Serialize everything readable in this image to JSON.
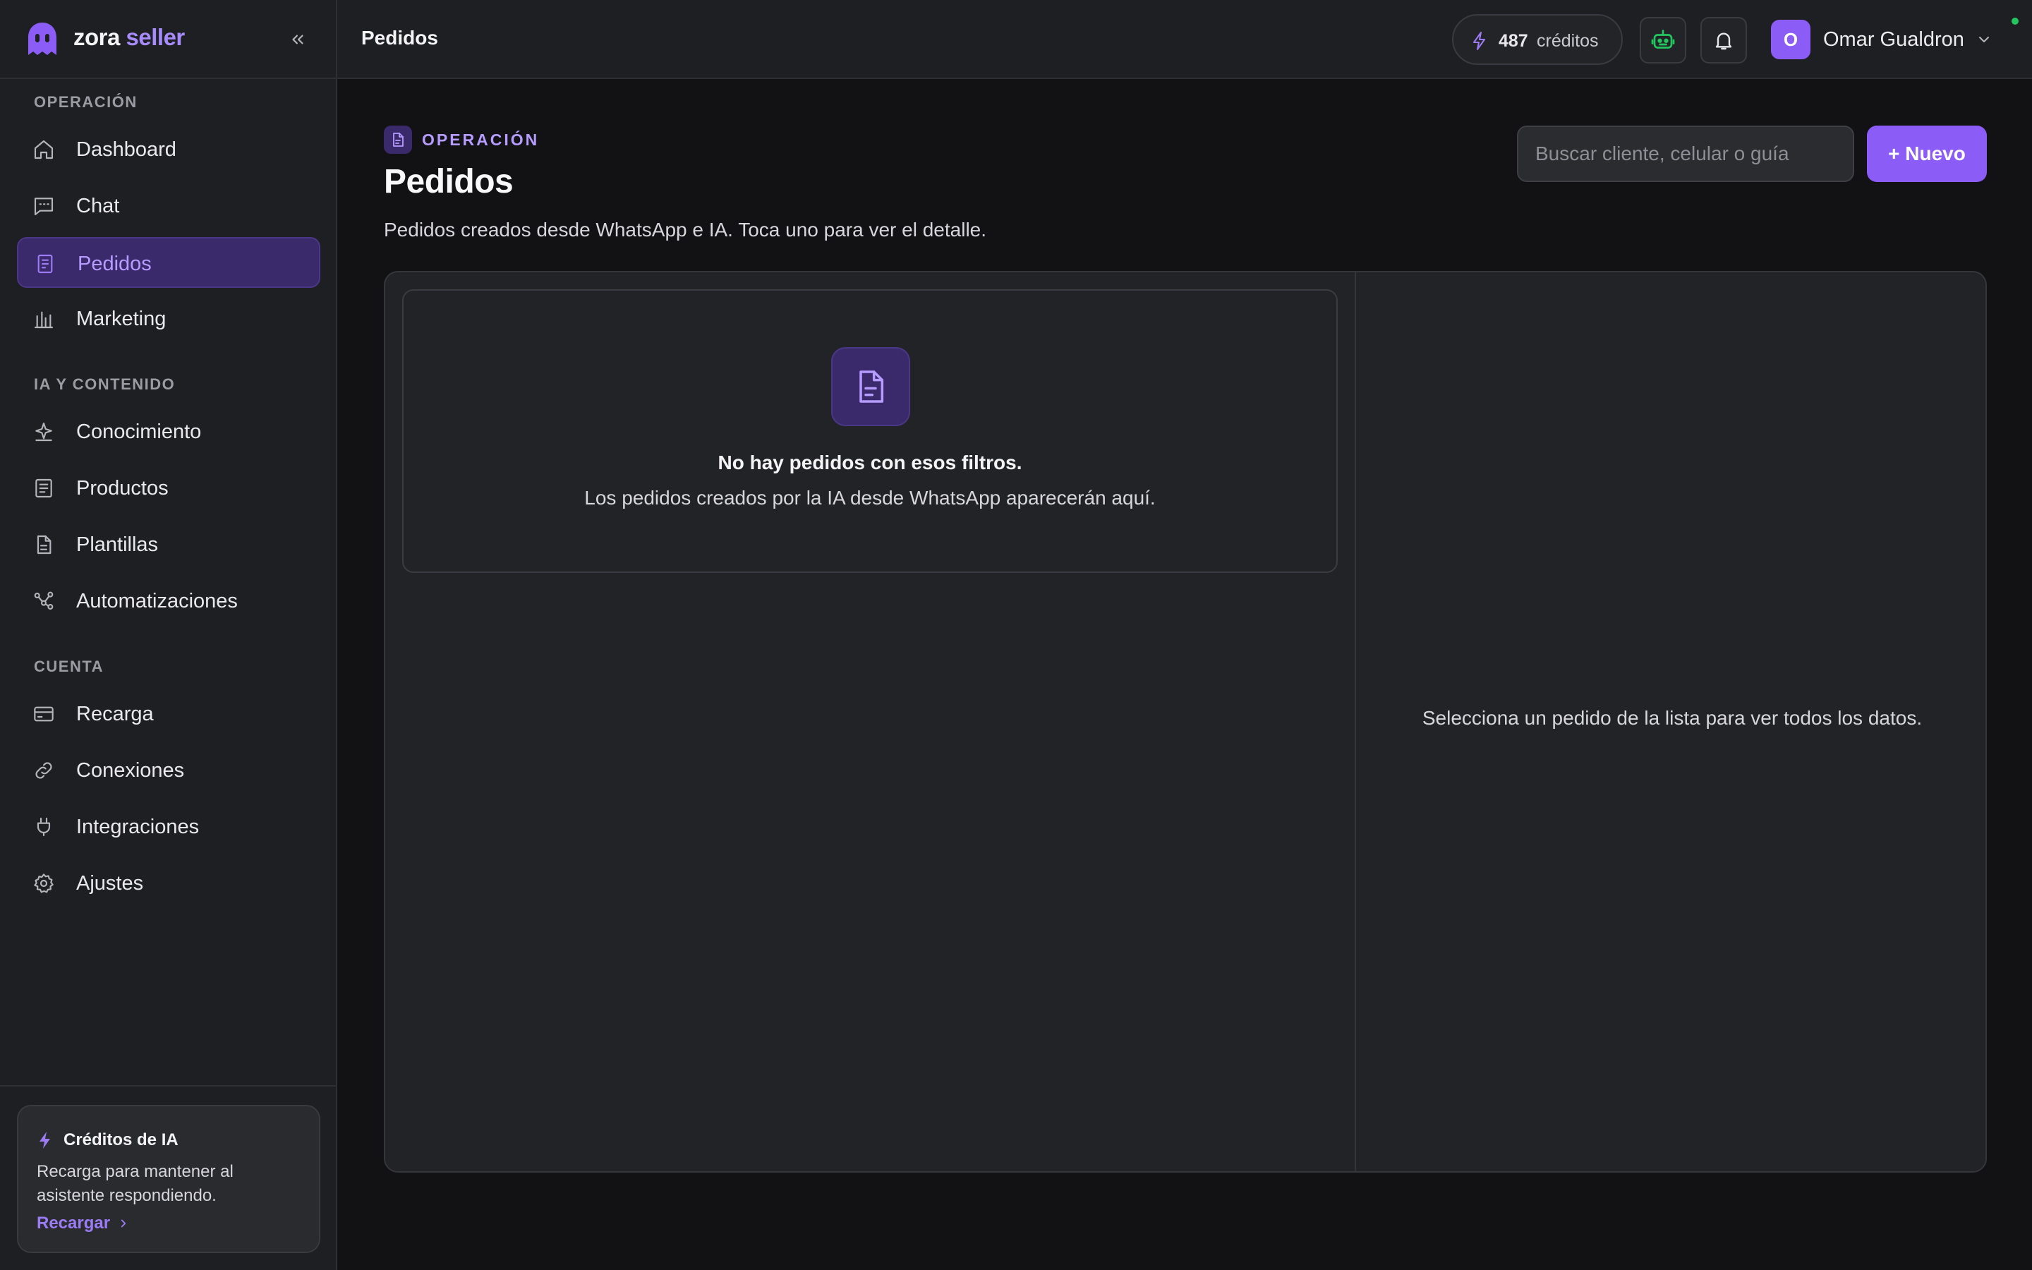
{
  "brand": {
    "name_primary": "zora",
    "name_accent": "seller"
  },
  "sidebar": {
    "sections": [
      {
        "title": "OPERACIÓN",
        "items": [
          {
            "label": "Dashboard",
            "icon": "home-icon"
          },
          {
            "label": "Chat",
            "icon": "chat-icon"
          },
          {
            "label": "Pedidos",
            "icon": "document-icon",
            "active": true
          },
          {
            "label": "Marketing",
            "icon": "bank-icon"
          }
        ]
      },
      {
        "title": "IA Y CONTENIDO",
        "items": [
          {
            "label": "Conocimiento",
            "icon": "sparkle-icon"
          },
          {
            "label": "Productos",
            "icon": "book-icon"
          },
          {
            "label": "Plantillas",
            "icon": "file-icon"
          },
          {
            "label": "Automatizaciones",
            "icon": "workflow-icon"
          }
        ]
      },
      {
        "title": "CUENTA",
        "items": [
          {
            "label": "Recarga",
            "icon": "credit-card-icon"
          },
          {
            "label": "Conexiones",
            "icon": "link-icon"
          },
          {
            "label": "Integraciones",
            "icon": "plug-icon"
          },
          {
            "label": "Ajustes",
            "icon": "gear-icon"
          }
        ]
      }
    ],
    "credits_card": {
      "title": "Créditos de IA",
      "text": "Recarga para mantener al asistente respondiendo.",
      "link": "Recargar"
    }
  },
  "topbar": {
    "title": "Pedidos",
    "credits_value": "487",
    "credits_unit": "créditos",
    "user_initial": "O",
    "user_name": "Omar Gualdron"
  },
  "main": {
    "eyebrow": "OPERACIÓN",
    "title": "Pedidos",
    "subtitle": "Pedidos creados desde WhatsApp e IA. Toca uno para ver el detalle.",
    "search_placeholder": "Buscar cliente, celular o guía",
    "search_value": "",
    "new_button": "+ Nuevo",
    "empty_title": "No hay pedidos con esos filtros.",
    "empty_text": "Los pedidos creados por la IA desde WhatsApp aparecerán aquí.",
    "detail_hint": "Selecciona un pedido de la lista para ver todos los datos."
  },
  "colors": {
    "accent": "#8b5cf6",
    "accent_text": "#b69cff",
    "active_bg": "#3b2a6b",
    "online": "#22c55e",
    "bot": "#22c55e"
  }
}
